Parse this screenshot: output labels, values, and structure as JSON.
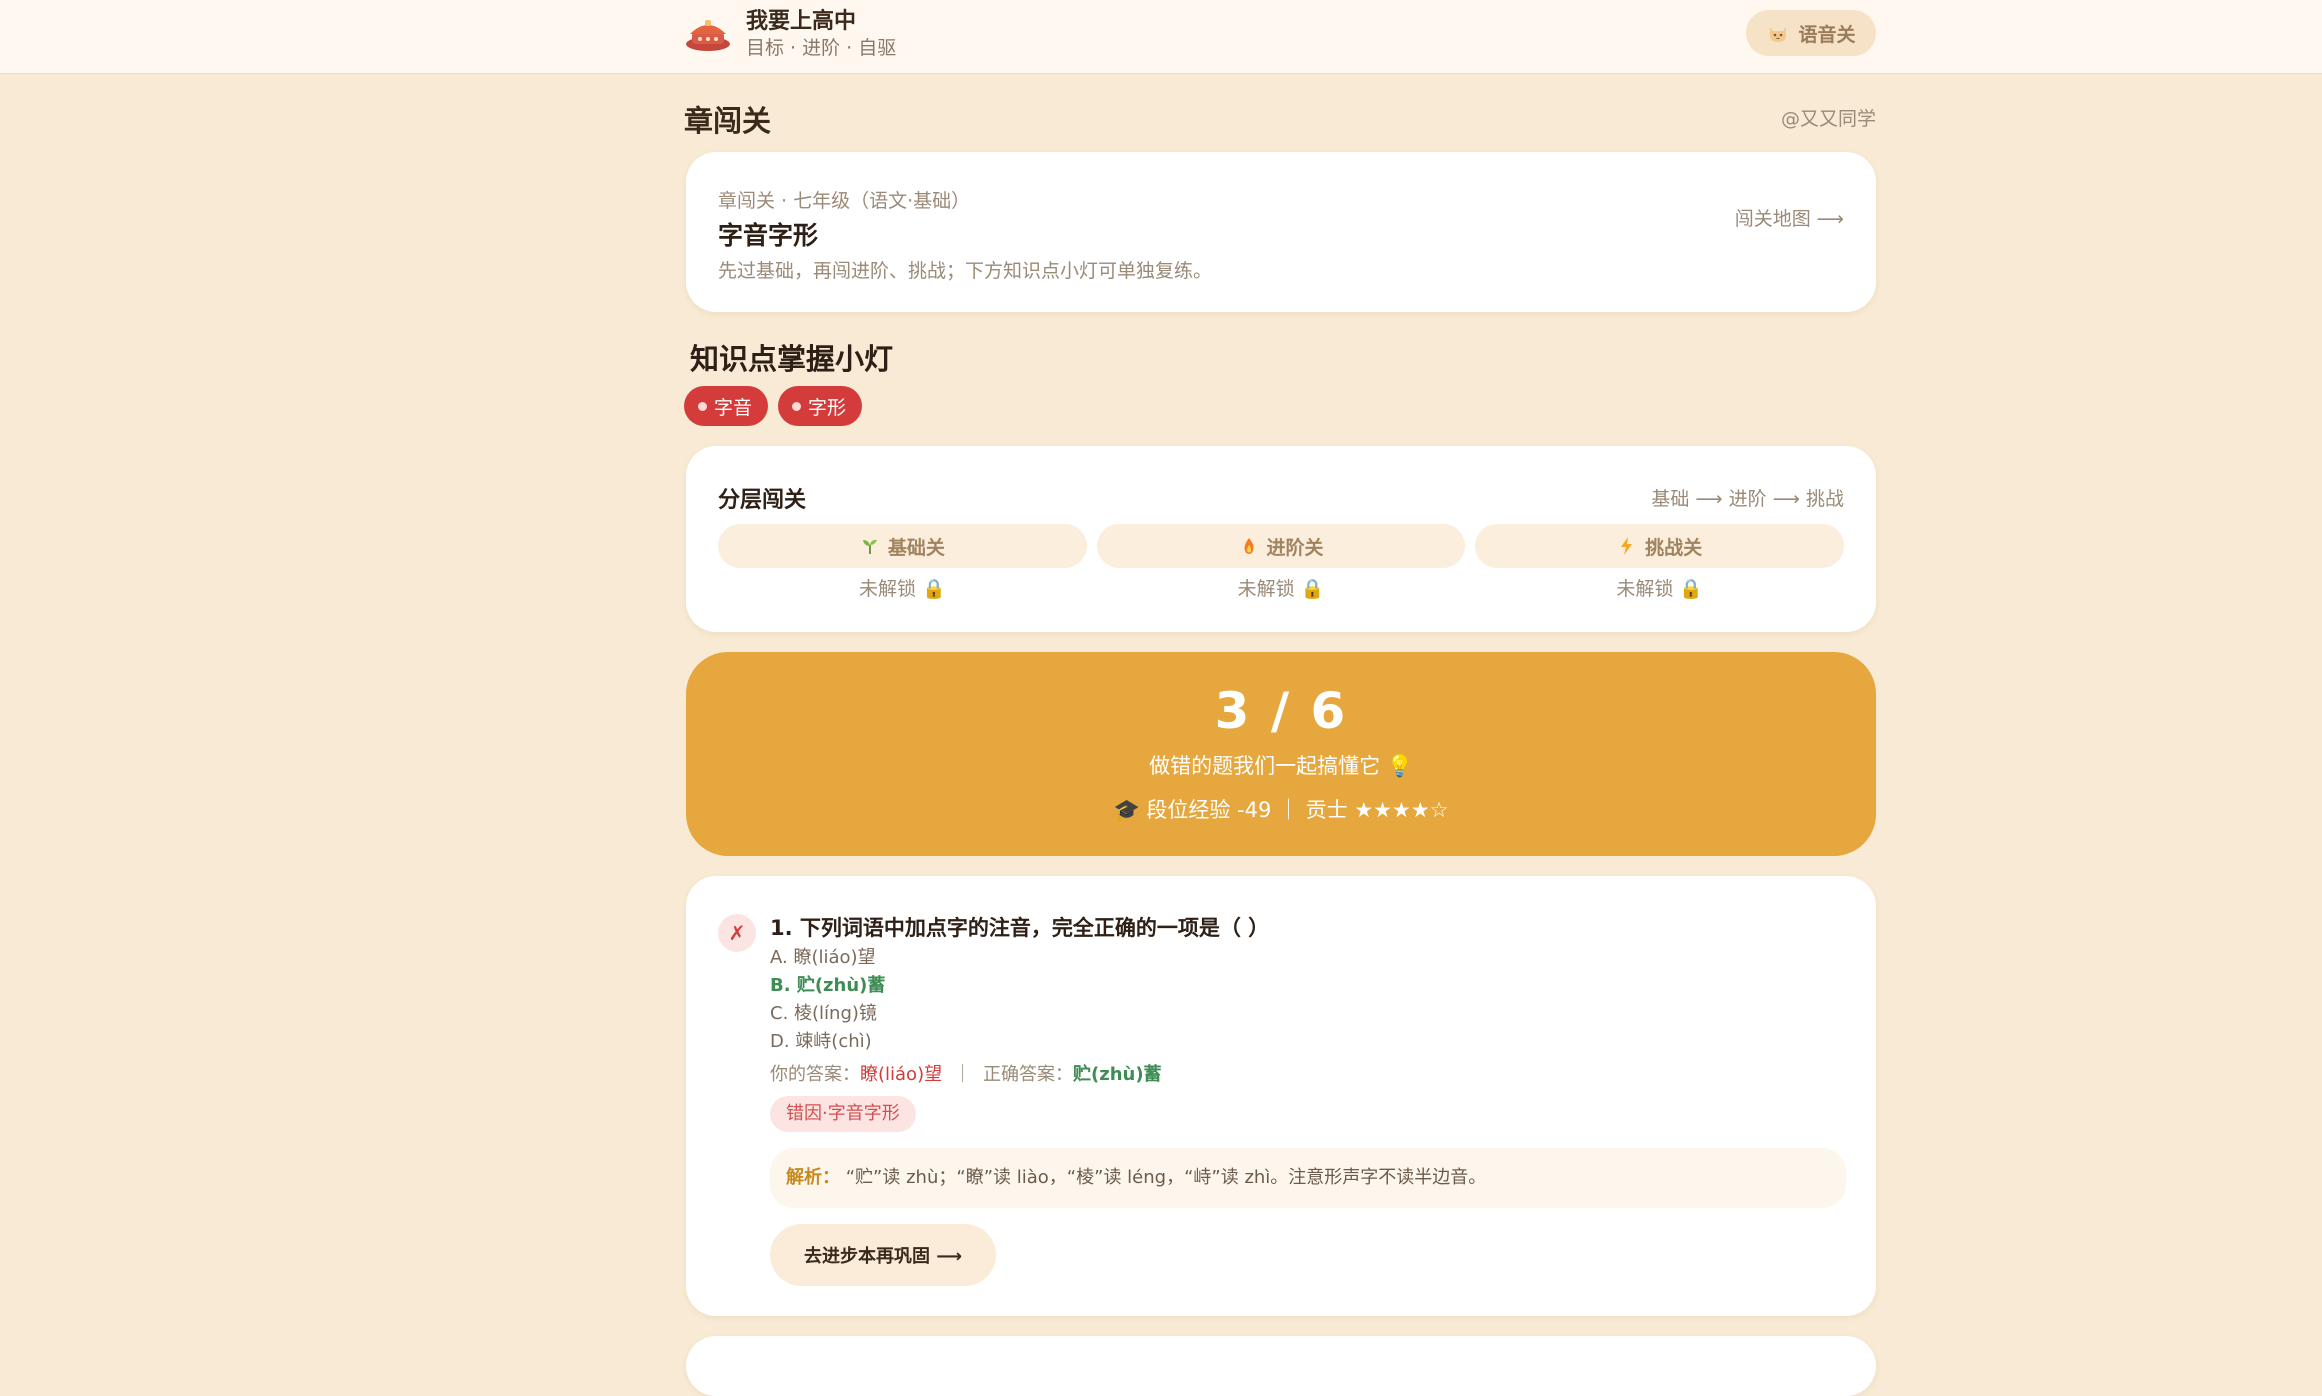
{
  "header": {
    "app_title": "我要上高中",
    "app_subtitle": "目标 · 进阶 · 自驱",
    "voice_button_label": "语音关"
  },
  "page": {
    "title": "章闯关",
    "user_handle": "@又又同学"
  },
  "intro": {
    "crumb": "章闯关 · 七年级（语文·基础）",
    "title": "字音字形",
    "description": "先过基础，再闯进阶、挑战；下方知识点小灯可单独复练。",
    "map_link": "闯关地图 ⟶"
  },
  "knowledge_points": {
    "title": "知识点掌握小灯",
    "chips": [
      {
        "label": "字音"
      },
      {
        "label": "字形"
      }
    ]
  },
  "layers": {
    "title": "分层闯关",
    "path": "基础 ⟶ 进阶 ⟶ 挑战",
    "levels": [
      {
        "label": "基础关",
        "status": "未解锁 🔒",
        "icon": "sprout-icon"
      },
      {
        "label": "进阶关",
        "status": "未解锁 🔒",
        "icon": "flame-icon"
      },
      {
        "label": "挑战关",
        "status": "未解锁 🔒",
        "icon": "lightning-icon"
      }
    ]
  },
  "result": {
    "score": "3 / 6",
    "message": "做错的题我们一起搞懂它 💡",
    "stats": "🎓 段位经验 -49 ｜ 贡士 ★★★★☆"
  },
  "question": {
    "mark": "✗",
    "title": "1. 下列词语中加点字的注音，完全正确的一项是（ ）",
    "options": [
      {
        "text": "A. 瞭(liáo)望",
        "correct": false
      },
      {
        "text": "B. 贮(zhù)蓄",
        "correct": true
      },
      {
        "text": "C. 棱(líng)镜",
        "correct": false
      },
      {
        "text": "D. 竦峙(chì)",
        "correct": false
      }
    ],
    "your_answer_label": "你的答案：",
    "your_answer": "瞭(liáo)望",
    "separator": "｜",
    "correct_answer_label": "正确答案：",
    "correct_answer": "贮(zhù)蓄",
    "error_tag": "错因·字音字形",
    "explain_label": "解析：",
    "explain_text": "“贮”读 zhù；“瞭”读 liào，“棱”读 léng，“峙”读 zhì。注意形声字不读半边音。",
    "action_label": "去进步本再巩固 ⟶"
  },
  "colors": {
    "background": "#f8ead4",
    "accent_orange": "#e5a73e",
    "chip_red": "#d43b3b",
    "correct_green": "#3f8c55"
  }
}
